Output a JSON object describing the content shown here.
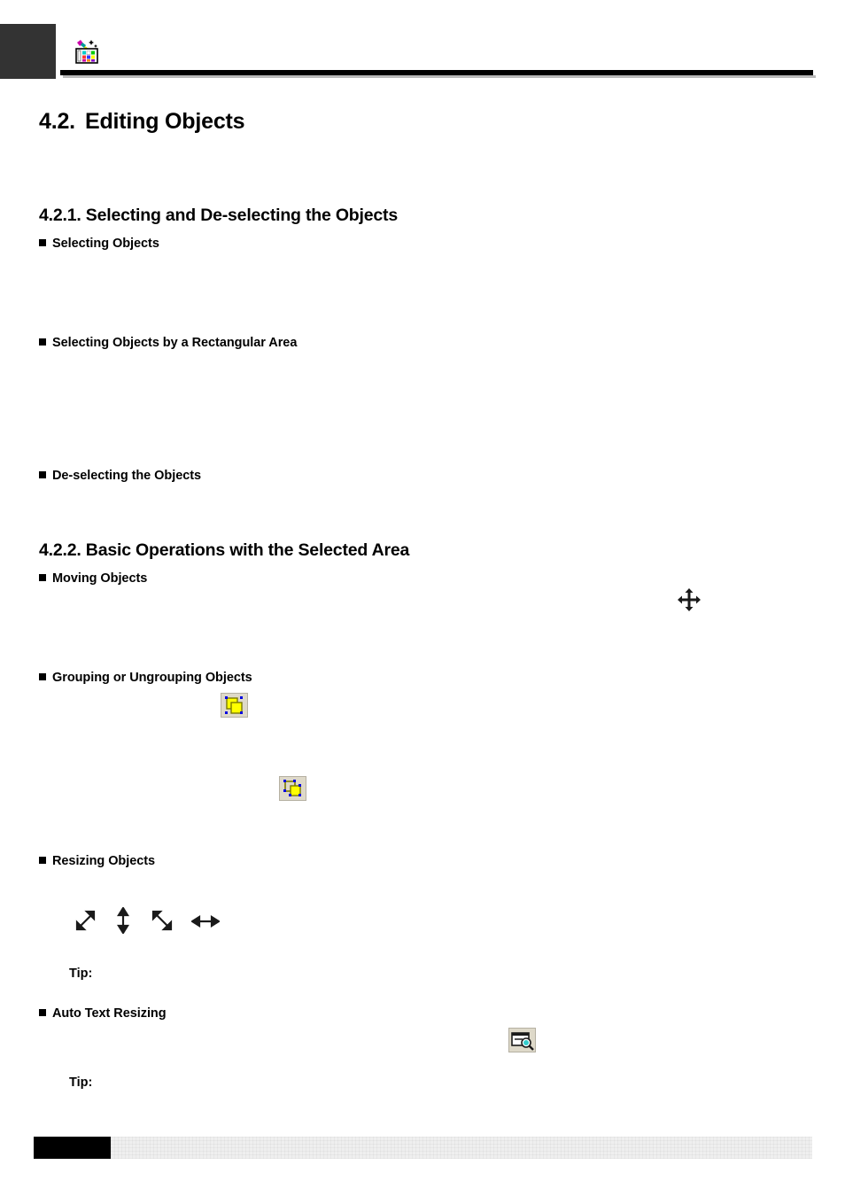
{
  "document": {
    "header": {
      "icon": "paint-palette-icon",
      "tab_color": "#333333",
      "rule_color": "#000000"
    },
    "section": {
      "number": "4.2.",
      "title": "Editing Objects"
    },
    "subsections": [
      {
        "number": "4.2.1.",
        "title": "Selecting and De-selecting the Objects",
        "full": "4.2.1. Selecting and De-selecting the Objects"
      },
      {
        "number": "4.2.2.",
        "title": "Basic Operations with the Selected Area",
        "full": "4.2.2. Basic Operations with the Selected Area"
      }
    ],
    "bullets": [
      {
        "label": "Selecting Objects"
      },
      {
        "label": "Selecting Objects by a Rectangular Area"
      },
      {
        "label": "De-selecting the Objects"
      },
      {
        "label": "Moving Objects"
      },
      {
        "label": "Grouping or Ungrouping Objects"
      },
      {
        "label": "Resizing Objects"
      },
      {
        "label": "Auto Text Resizing"
      }
    ],
    "tips": [
      {
        "label": "Tip:"
      },
      {
        "label": "Tip:"
      }
    ],
    "icons": {
      "move_cursor": "move-four-way-arrow-cursor",
      "group_button": "group-objects-button",
      "ungroup_button": "ungroup-objects-button",
      "resize_cursors": [
        "resize-diagonal-ne-sw-cursor",
        "resize-vertical-cursor",
        "resize-diagonal-nw-se-cursor",
        "resize-horizontal-cursor"
      ],
      "auto_text_resize_button": "auto-text-resize-button"
    },
    "colors": {
      "group_fill": "#ffff00",
      "group_outline": "#808000",
      "handle": "#0000ff",
      "button_face": "#ded9c9",
      "page_background": "#ffffff",
      "tab": "#333333",
      "footer_block": "#000000",
      "footer_bar": "#efefef"
    },
    "footer": {
      "block_label": "",
      "bar_label": ""
    }
  }
}
